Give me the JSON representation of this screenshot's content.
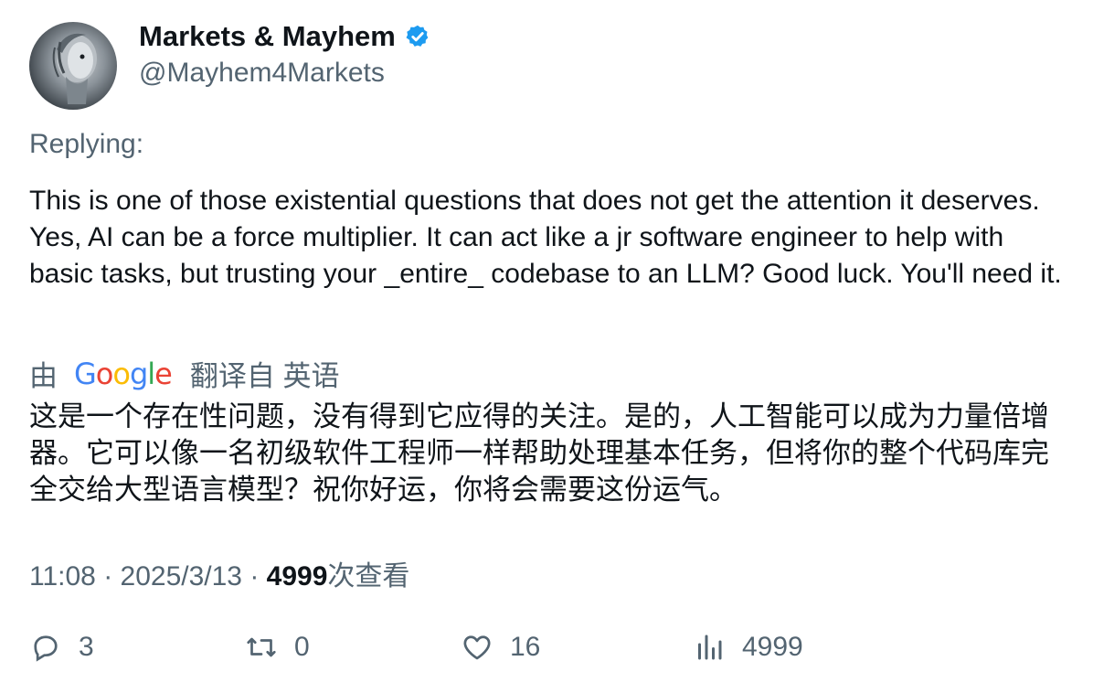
{
  "author": {
    "display_name": "Markets & Mayhem",
    "handle": "@Mayhem4Markets",
    "avatar_icon": "robot-avatar",
    "verified_icon": "verified-badge-icon",
    "verified_color": "#1d9bf0"
  },
  "replying_label": "Replying:",
  "tweet_text": "This is one of those existential questions that does not get the attention it deserves. Yes, AI can be a force multiplier. It can act like a jr software engineer to help with basic tasks, but trusting your _entire_ codebase to an LLM? Good luck. You'll need it.",
  "translation": {
    "by_label": "由",
    "provider": "Google",
    "from_label": "翻译自 英语",
    "text": "这是一个存在性问题，没有得到它应得的关注。是的，人工智能可以成为力量倍增器。它可以像一名初级软件工程师一样帮助处理基本任务，但将你的整个代码库完全交给大型语言模型？祝你好运，你将会需要这份运气。"
  },
  "meta": {
    "time": "11:08",
    "separator": " · ",
    "date": "2025/3/13",
    "views_count": "4999",
    "views_label": "次查看"
  },
  "actions": {
    "replies": "3",
    "retweets": "0",
    "likes": "16",
    "views": "4999"
  }
}
